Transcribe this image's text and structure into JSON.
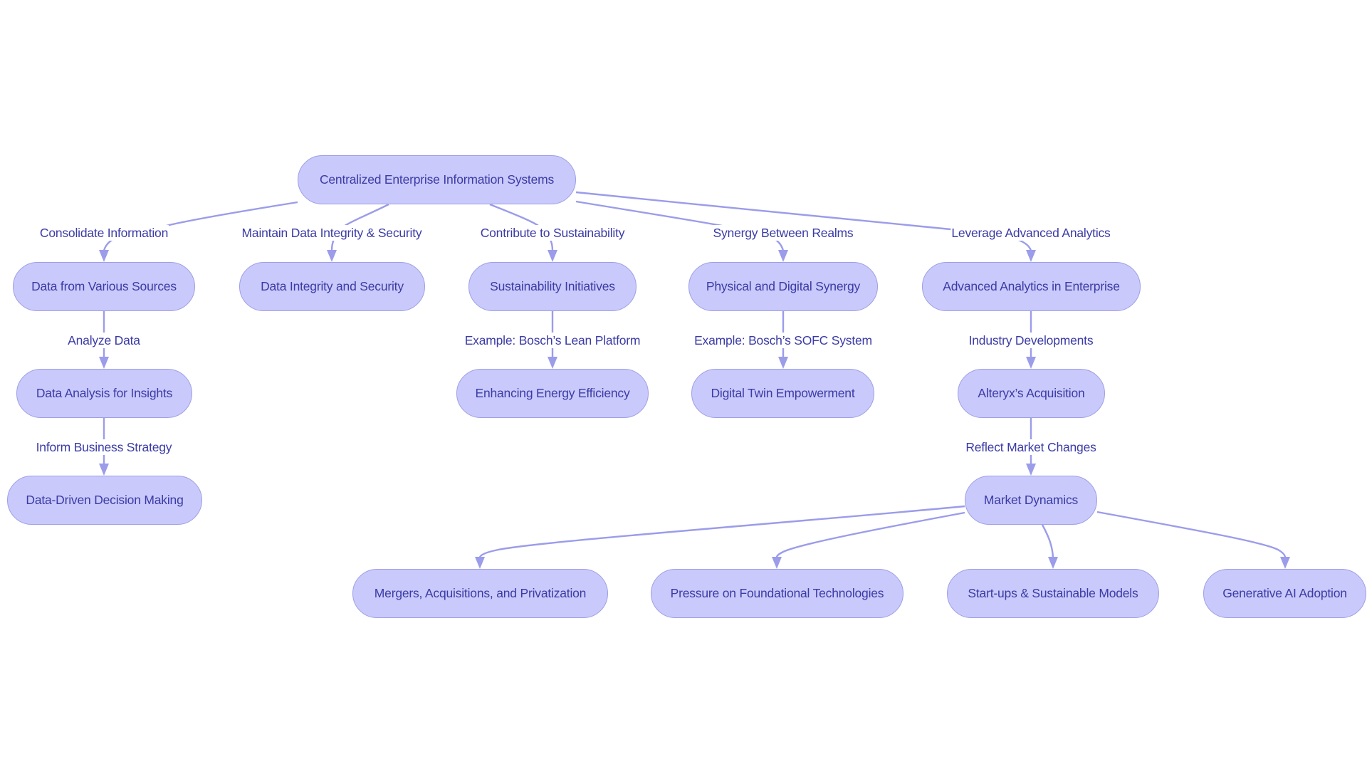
{
  "diagram": {
    "type": "flowchart",
    "colors": {
      "node_fill": "#c9c9fb",
      "node_border": "#9e9fe6",
      "edge": "#9b9cea",
      "text": "#3b3ba6"
    },
    "nodes": [
      {
        "id": "root",
        "label": "Centralized Enterprise Information Systems"
      },
      {
        "id": "sources",
        "label": "Data from Various Sources"
      },
      {
        "id": "integrity",
        "label": "Data Integrity and Security"
      },
      {
        "id": "sustain",
        "label": "Sustainability Initiatives"
      },
      {
        "id": "synergy",
        "label": "Physical and Digital Synergy"
      },
      {
        "id": "analytics",
        "label": "Advanced Analytics in Enterprise"
      },
      {
        "id": "analysis",
        "label": "Data Analysis for Insights"
      },
      {
        "id": "energy",
        "label": "Enhancing Energy Efficiency"
      },
      {
        "id": "twin",
        "label": "Digital Twin Empowerment"
      },
      {
        "id": "alteryx",
        "label": "Alteryx’s Acquisition"
      },
      {
        "id": "decision",
        "label": "Data-Driven Decision Making"
      },
      {
        "id": "market",
        "label": "Market Dynamics"
      },
      {
        "id": "mergers",
        "label": "Mergers, Acquisitions, and Privatization"
      },
      {
        "id": "pressure",
        "label": "Pressure on Foundational Technologies"
      },
      {
        "id": "startups",
        "label": "Start-ups & Sustainable Models"
      },
      {
        "id": "genai",
        "label": "Generative AI Adoption"
      }
    ],
    "edges": [
      {
        "from": "root",
        "to": "sources",
        "label": "Consolidate Information"
      },
      {
        "from": "root",
        "to": "integrity",
        "label": "Maintain Data Integrity & Security"
      },
      {
        "from": "root",
        "to": "sustain",
        "label": "Contribute to Sustainability"
      },
      {
        "from": "root",
        "to": "synergy",
        "label": "Synergy Between Realms"
      },
      {
        "from": "root",
        "to": "analytics",
        "label": "Leverage Advanced Analytics"
      },
      {
        "from": "sources",
        "to": "analysis",
        "label": "Analyze Data"
      },
      {
        "from": "analysis",
        "to": "decision",
        "label": "Inform Business Strategy"
      },
      {
        "from": "sustain",
        "to": "energy",
        "label": "Example: Bosch’s Lean Platform"
      },
      {
        "from": "synergy",
        "to": "twin",
        "label": "Example: Bosch’s SOFC System"
      },
      {
        "from": "analytics",
        "to": "alteryx",
        "label": "Industry Developments"
      },
      {
        "from": "alteryx",
        "to": "market",
        "label": "Reflect Market Changes"
      },
      {
        "from": "market",
        "to": "mergers",
        "label": ""
      },
      {
        "from": "market",
        "to": "pressure",
        "label": ""
      },
      {
        "from": "market",
        "to": "startups",
        "label": ""
      },
      {
        "from": "market",
        "to": "genai",
        "label": ""
      }
    ]
  }
}
